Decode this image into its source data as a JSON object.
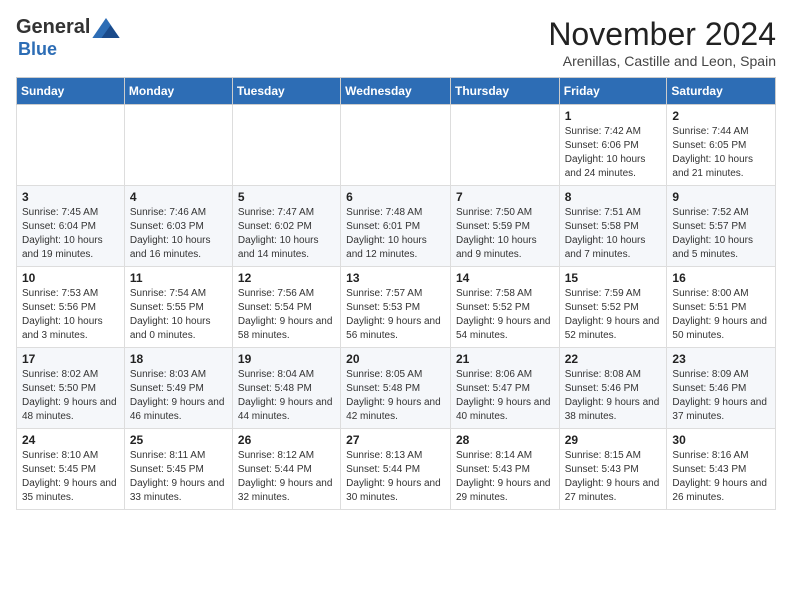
{
  "header": {
    "logo_general": "General",
    "logo_blue": "Blue",
    "month_title": "November 2024",
    "subtitle": "Arenillas, Castille and Leon, Spain"
  },
  "days_of_week": [
    "Sunday",
    "Monday",
    "Tuesday",
    "Wednesday",
    "Thursday",
    "Friday",
    "Saturday"
  ],
  "weeks": [
    [
      {
        "day": "",
        "info": ""
      },
      {
        "day": "",
        "info": ""
      },
      {
        "day": "",
        "info": ""
      },
      {
        "day": "",
        "info": ""
      },
      {
        "day": "",
        "info": ""
      },
      {
        "day": "1",
        "info": "Sunrise: 7:42 AM\nSunset: 6:06 PM\nDaylight: 10 hours and 24 minutes."
      },
      {
        "day": "2",
        "info": "Sunrise: 7:44 AM\nSunset: 6:05 PM\nDaylight: 10 hours and 21 minutes."
      }
    ],
    [
      {
        "day": "3",
        "info": "Sunrise: 7:45 AM\nSunset: 6:04 PM\nDaylight: 10 hours and 19 minutes."
      },
      {
        "day": "4",
        "info": "Sunrise: 7:46 AM\nSunset: 6:03 PM\nDaylight: 10 hours and 16 minutes."
      },
      {
        "day": "5",
        "info": "Sunrise: 7:47 AM\nSunset: 6:02 PM\nDaylight: 10 hours and 14 minutes."
      },
      {
        "day": "6",
        "info": "Sunrise: 7:48 AM\nSunset: 6:01 PM\nDaylight: 10 hours and 12 minutes."
      },
      {
        "day": "7",
        "info": "Sunrise: 7:50 AM\nSunset: 5:59 PM\nDaylight: 10 hours and 9 minutes."
      },
      {
        "day": "8",
        "info": "Sunrise: 7:51 AM\nSunset: 5:58 PM\nDaylight: 10 hours and 7 minutes."
      },
      {
        "day": "9",
        "info": "Sunrise: 7:52 AM\nSunset: 5:57 PM\nDaylight: 10 hours and 5 minutes."
      }
    ],
    [
      {
        "day": "10",
        "info": "Sunrise: 7:53 AM\nSunset: 5:56 PM\nDaylight: 10 hours and 3 minutes."
      },
      {
        "day": "11",
        "info": "Sunrise: 7:54 AM\nSunset: 5:55 PM\nDaylight: 10 hours and 0 minutes."
      },
      {
        "day": "12",
        "info": "Sunrise: 7:56 AM\nSunset: 5:54 PM\nDaylight: 9 hours and 58 minutes."
      },
      {
        "day": "13",
        "info": "Sunrise: 7:57 AM\nSunset: 5:53 PM\nDaylight: 9 hours and 56 minutes."
      },
      {
        "day": "14",
        "info": "Sunrise: 7:58 AM\nSunset: 5:52 PM\nDaylight: 9 hours and 54 minutes."
      },
      {
        "day": "15",
        "info": "Sunrise: 7:59 AM\nSunset: 5:52 PM\nDaylight: 9 hours and 52 minutes."
      },
      {
        "day": "16",
        "info": "Sunrise: 8:00 AM\nSunset: 5:51 PM\nDaylight: 9 hours and 50 minutes."
      }
    ],
    [
      {
        "day": "17",
        "info": "Sunrise: 8:02 AM\nSunset: 5:50 PM\nDaylight: 9 hours and 48 minutes."
      },
      {
        "day": "18",
        "info": "Sunrise: 8:03 AM\nSunset: 5:49 PM\nDaylight: 9 hours and 46 minutes."
      },
      {
        "day": "19",
        "info": "Sunrise: 8:04 AM\nSunset: 5:48 PM\nDaylight: 9 hours and 44 minutes."
      },
      {
        "day": "20",
        "info": "Sunrise: 8:05 AM\nSunset: 5:48 PM\nDaylight: 9 hours and 42 minutes."
      },
      {
        "day": "21",
        "info": "Sunrise: 8:06 AM\nSunset: 5:47 PM\nDaylight: 9 hours and 40 minutes."
      },
      {
        "day": "22",
        "info": "Sunrise: 8:08 AM\nSunset: 5:46 PM\nDaylight: 9 hours and 38 minutes."
      },
      {
        "day": "23",
        "info": "Sunrise: 8:09 AM\nSunset: 5:46 PM\nDaylight: 9 hours and 37 minutes."
      }
    ],
    [
      {
        "day": "24",
        "info": "Sunrise: 8:10 AM\nSunset: 5:45 PM\nDaylight: 9 hours and 35 minutes."
      },
      {
        "day": "25",
        "info": "Sunrise: 8:11 AM\nSunset: 5:45 PM\nDaylight: 9 hours and 33 minutes."
      },
      {
        "day": "26",
        "info": "Sunrise: 8:12 AM\nSunset: 5:44 PM\nDaylight: 9 hours and 32 minutes."
      },
      {
        "day": "27",
        "info": "Sunrise: 8:13 AM\nSunset: 5:44 PM\nDaylight: 9 hours and 30 minutes."
      },
      {
        "day": "28",
        "info": "Sunrise: 8:14 AM\nSunset: 5:43 PM\nDaylight: 9 hours and 29 minutes."
      },
      {
        "day": "29",
        "info": "Sunrise: 8:15 AM\nSunset: 5:43 PM\nDaylight: 9 hours and 27 minutes."
      },
      {
        "day": "30",
        "info": "Sunrise: 8:16 AM\nSunset: 5:43 PM\nDaylight: 9 hours and 26 minutes."
      }
    ]
  ]
}
